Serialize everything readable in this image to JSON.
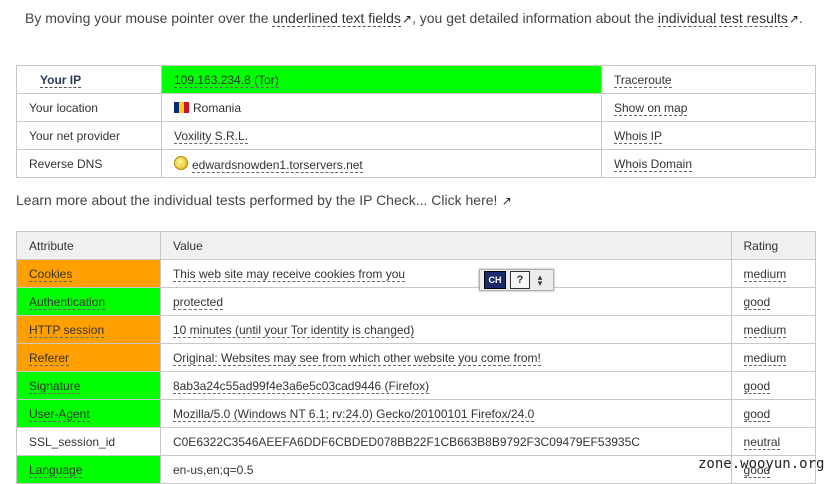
{
  "intro": {
    "part1": "By moving your mouse pointer over the",
    "link1": "underlined text fields",
    "part2": ", you get detailed information about the",
    "link2": "individual test results",
    "part3": "."
  },
  "ip_info": {
    "rows": [
      {
        "label": "Your IP",
        "value": "109.163.234.8 (Tor)",
        "action": "Traceroute"
      },
      {
        "label": "Your location",
        "value": "Romania",
        "action": "Show on map"
      },
      {
        "label": "Your net provider",
        "value": "Voxility S.R.L.",
        "action": "Whois IP"
      },
      {
        "label": "Reverse DNS",
        "value": "edwardsnowden1.torservers.net",
        "action": "Whois Domain"
      }
    ]
  },
  "learn_more": "Learn more about the individual tests performed by the IP Check... Click here!",
  "attributes": {
    "headers": [
      "Attribute",
      "Value",
      "Rating"
    ],
    "rows": [
      {
        "attribute": "Cookies",
        "value": "This web site may receive cookies from you",
        "rating": "medium"
      },
      {
        "attribute": "Authentication",
        "value": "protected",
        "rating": "good"
      },
      {
        "attribute": "HTTP session",
        "value": "10 minutes (until your Tor identity is changed)",
        "rating": "medium"
      },
      {
        "attribute": "Referer",
        "value": "Original: Websites may see from which other website you come from!",
        "rating": "medium"
      },
      {
        "attribute": "Signature",
        "value": "8ab3a24c55ad99f4e3a6e5c03cad9446 (Firefox)",
        "rating": "good"
      },
      {
        "attribute": "User-Agent",
        "value": "Mozilla/5.0 (Windows NT 6.1; rv:24.0) Gecko/20100101 Firefox/24.0",
        "rating": "good"
      },
      {
        "attribute": "SSL_session_id",
        "value": "C0E6322C3546AEEFA6DDF6CBDED078BB22F1CB663B8B9792F3C09479EF53935C",
        "rating": "neutral"
      },
      {
        "attribute": "Language",
        "value": "en-us,en;q=0.5",
        "rating": "good"
      }
    ]
  },
  "colors": {
    "good": "#00ff00",
    "medium": "#ffa000",
    "neutral": "#ffffff"
  },
  "ime": {
    "mode": "CH",
    "help": "?"
  },
  "watermark": "zone.wooyun.org"
}
